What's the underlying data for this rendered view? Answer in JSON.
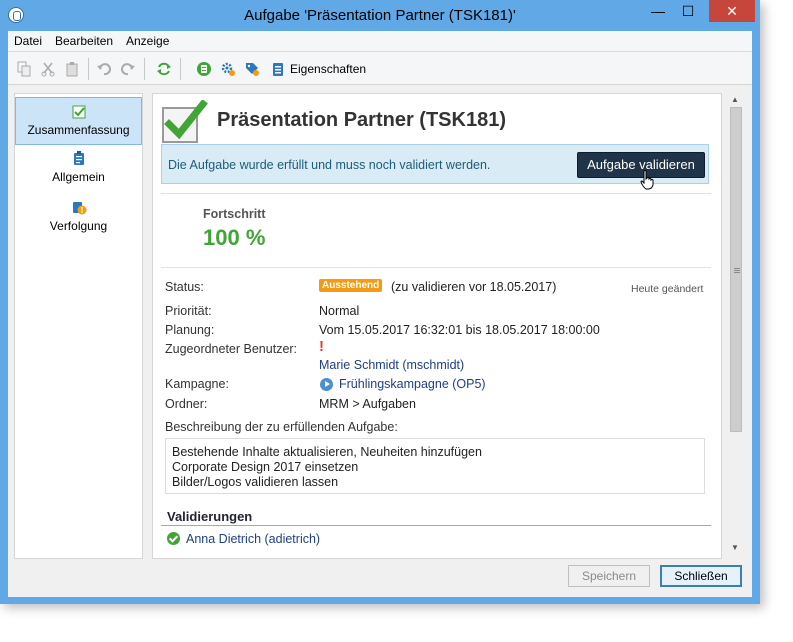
{
  "window": {
    "title": "Aufgabe 'Präsentation Partner (TSK181)'",
    "minimize": "—",
    "maximize": "☐",
    "close": "✕"
  },
  "menu": [
    "Datei",
    "Bearbeiten",
    "Anzeige"
  ],
  "toolbar": {
    "properties_label": "Eigenschaften"
  },
  "sidebar": {
    "items": [
      {
        "label": "Zusammenfassung",
        "icon": "checklist-icon",
        "active": true
      },
      {
        "label": "Allgemein",
        "icon": "clipboard-icon"
      },
      {
        "label": "Verfolgung",
        "icon": "tracking-icon"
      }
    ]
  },
  "task": {
    "title": "Präsentation Partner (TSK181)",
    "notice": "Die Aufgabe wurde erfüllt und muss noch validiert werden.",
    "validate_label": "Aufgabe validieren",
    "progress_label": "Fortschritt",
    "progress_value": "100 %",
    "status_label": "Status:",
    "status_badge": "Ausstehend",
    "status_text": "(zu validieren vor 18.05.2017)",
    "changed": "Heute geändert",
    "priority_label": "Priorität:",
    "priority_value": "Normal",
    "planning_label": "Planung:",
    "planning_value": "Vom 15.05.2017 16:32:01 bis 18.05.2017 18:00:00",
    "assignee_label": "Zugeordneter Benutzer:",
    "assignee_mark": "!",
    "assignee_value": "Marie Schmidt (mschmidt)",
    "campaign_label": "Kampagne:",
    "campaign_value": "Frühlingskampagne (OP5)",
    "folder_label": "Ordner:",
    "folder_value": "MRM > Aufgaben",
    "description_label": "Beschreibung der zu erfüllenden Aufgabe:",
    "description_lines": [
      "Bestehende Inhalte aktualisieren, Neuheiten hinzufügen",
      "Corporate Design 2017 einsetzen",
      "Bilder/Logos validieren lassen"
    ],
    "validations_label": "Validierungen",
    "validator": "Anna Dietrich (adietrich)"
  },
  "footer": {
    "save_label": "Speichern",
    "close_label": "Schließen"
  },
  "colors": {
    "titlebar": "#60a8e6",
    "close": "#c7463c",
    "progress": "#3fa535",
    "badge": "#f39c12",
    "primary_button": "#1f3449"
  }
}
